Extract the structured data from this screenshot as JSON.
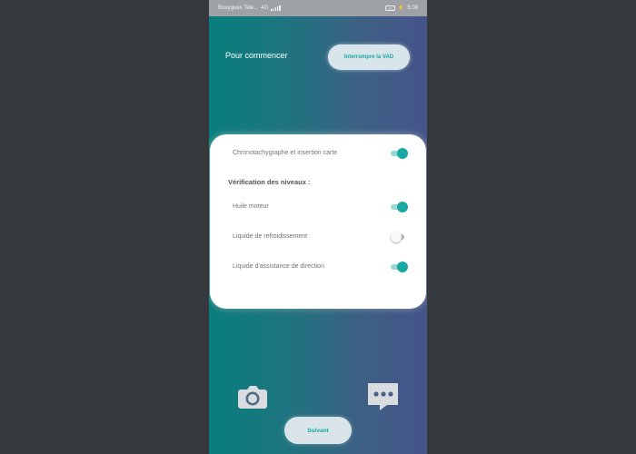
{
  "status_bar": {
    "carrier": "Bouygues Tele...",
    "network": "4G",
    "battery": "79",
    "time": "5:09"
  },
  "header": {
    "title": "Pour commencer",
    "top_button_label": "Interrompre la VAD"
  },
  "checklist": {
    "items": [
      {
        "label": "Chronotachygraphe et insertion carte",
        "enabled": true
      },
      {
        "label": "Huile moteur",
        "enabled": true
      },
      {
        "label": "Liquide de refroidissement",
        "enabled": false
      },
      {
        "label": "Liquide d'assistance de direction",
        "enabled": true
      }
    ],
    "section_title": "Vérification des niveaux :"
  },
  "footer": {
    "next_label": "Suivant"
  },
  "icons": {
    "camera": "camera-icon",
    "chat": "chat-icon"
  },
  "colors": {
    "accent": "#19a8a3",
    "button_background": "#d8e5ea",
    "card_background": "#ffffff",
    "gradient_start": "#087f7c",
    "gradient_end": "#45548a"
  }
}
